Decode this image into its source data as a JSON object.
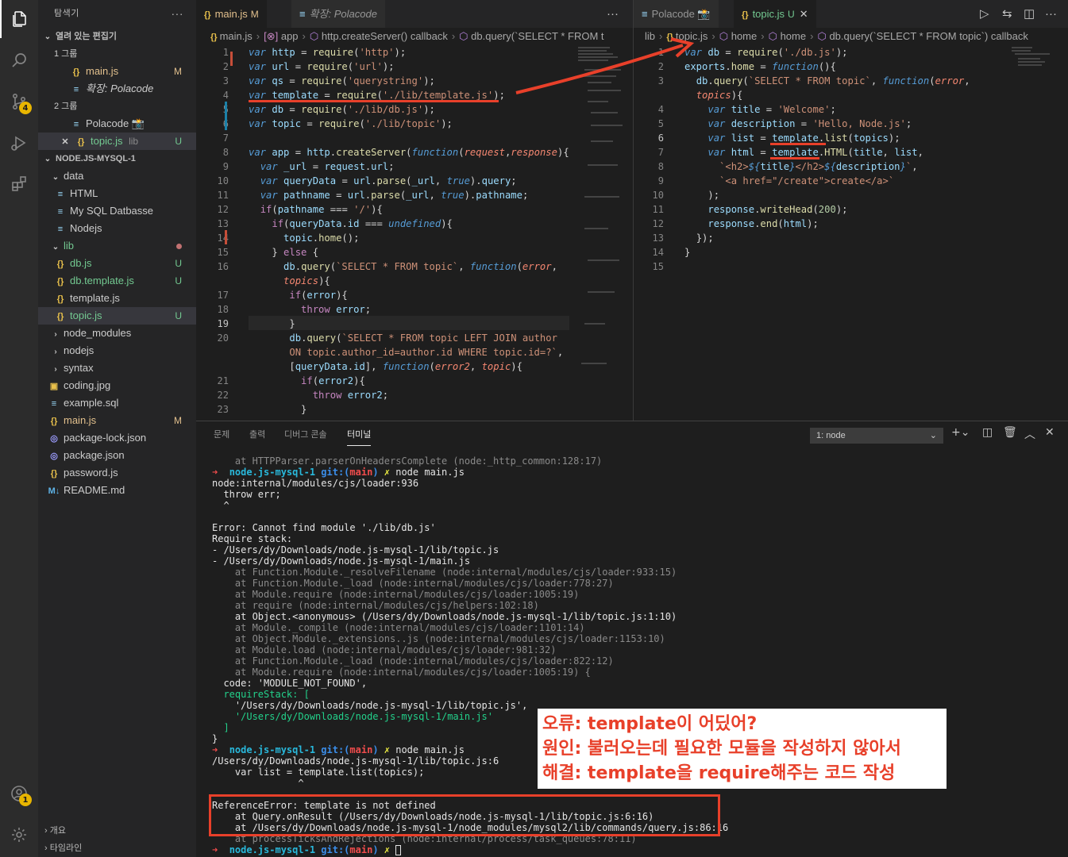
{
  "activity": {
    "scm_badge": "4",
    "account_badge": "1",
    "icons": [
      "files-icon",
      "search-icon",
      "source-control-icon",
      "run-debug-icon",
      "extensions-icon",
      "account-icon",
      "settings-gear-icon"
    ]
  },
  "sidebar": {
    "title": "탐색기",
    "more": "···",
    "open_editors": "열려 있는 편집기",
    "group1": "1 그룹",
    "group2": "2 그룹",
    "open": [
      {
        "label": "main.js",
        "badge": "M"
      },
      {
        "label": "확장: Polacode",
        "badge": ""
      },
      {
        "label": "Polacode 📸",
        "badge": ""
      },
      {
        "label": "topic.js",
        "extra": "lib",
        "badge": "U"
      }
    ],
    "project": "NODE.JS-MYSQL-1",
    "tree": [
      {
        "label": "data",
        "badge": ""
      },
      {
        "label": "HTML",
        "badge": ""
      },
      {
        "label": "My SQL Datbasse",
        "badge": ""
      },
      {
        "label": "Nodejs",
        "badge": ""
      },
      {
        "label": "lib",
        "badge": ""
      },
      {
        "label": "db.js",
        "badge": "U"
      },
      {
        "label": "db.template.js",
        "badge": "U"
      },
      {
        "label": "template.js",
        "badge": ""
      },
      {
        "label": "topic.js",
        "badge": "U"
      },
      {
        "label": "node_modules",
        "badge": ""
      },
      {
        "label": "nodejs",
        "badge": ""
      },
      {
        "label": "syntax",
        "badge": ""
      },
      {
        "label": "coding.jpg",
        "badge": ""
      },
      {
        "label": "example.sql",
        "badge": ""
      },
      {
        "label": "main.js",
        "badge": "M"
      },
      {
        "label": "package-lock.json",
        "badge": ""
      },
      {
        "label": "package.json",
        "badge": ""
      },
      {
        "label": "password.js",
        "badge": ""
      },
      {
        "label": "README.md",
        "badge": ""
      }
    ],
    "outline": "개요",
    "timeline": "타임라인"
  },
  "editor_left": {
    "tabs": [
      {
        "label": "main.js",
        "badge": "M"
      },
      {
        "label": "확장: Polacode"
      }
    ],
    "more": "···",
    "breadcrumb": [
      "main.js",
      "app",
      "http.createServer() callback",
      "db.query(`SELECT * FROM t"
    ],
    "line_numbers": [
      "1",
      "2",
      "3",
      "4",
      "5",
      "6",
      "7",
      "8",
      "9",
      "10",
      "11",
      "12",
      "13",
      "14",
      "15",
      "16",
      "",
      "17",
      "18",
      "19",
      "20",
      "",
      "",
      "21",
      "22",
      "23"
    ],
    "current_line": "19"
  },
  "editor_right": {
    "tabs": [
      {
        "label": "Polacode 📸"
      },
      {
        "label": "topic.js",
        "badge": "U"
      }
    ],
    "breadcrumb": [
      "lib",
      "topic.js",
      "home",
      "home",
      "db.query(`SELECT * FROM topic`) callback"
    ],
    "line_numbers": [
      "1",
      "2",
      "3",
      "",
      "4",
      "5",
      "6",
      "7",
      "8",
      "9",
      "10",
      "11",
      "12",
      "13",
      "14",
      "15"
    ],
    "current_line": "6"
  },
  "panel": {
    "tabs": [
      "문제",
      "출력",
      "디버그 콘솔",
      "터미널"
    ],
    "active_tab": "터미널",
    "terminal_select": "1: node",
    "terminal_lines": [
      "    at HTTPParser.parserOnHeadersComplete (node:_http_common:128:17)",
      "node:internal/modules/cjs/loader:936",
      "  throw err;",
      "  ^",
      "",
      "Error: Cannot find module './lib/db.js'",
      "Require stack:",
      "- /Users/dy/Downloads/node.js-mysql-1/lib/topic.js",
      "- /Users/dy/Downloads/node.js-mysql-1/main.js",
      "    at Function.Module._resolveFilename (node:internal/modules/cjs/loader:933:15)",
      "    at Function.Module._load (node:internal/modules/cjs/loader:778:27)",
      "    at Module.require (node:internal/modules/cjs/loader:1005:19)",
      "    at require (node:internal/modules/cjs/helpers:102:18)",
      "    at Object.<anonymous> (/Users/dy/Downloads/node.js-mysql-1/lib/topic.js:1:10)",
      "    at Module._compile (node:internal/modules/cjs/loader:1101:14)",
      "    at Object.Module._extensions..js (node:internal/modules/cjs/loader:1153:10)",
      "    at Module.load (node:internal/modules/cjs/loader:981:32)",
      "    at Function.Module._load (node:internal/modules/cjs/loader:822:12)",
      "    at Module.require (node:internal/modules/cjs/loader:1005:19) {",
      "  code: 'MODULE_NOT_FOUND',",
      "  requireStack: [",
      "    '/Users/dy/Downloads/node.js-mysql-1/lib/topic.js',",
      "    '/Users/dy/Downloads/node.js-mysql-1/main.js'",
      "  ]",
      "}",
      "/Users/dy/Downloads/node.js-mysql-1/lib/topic.js:6",
      "    var list = template.list(topics);",
      "               ^",
      "",
      "ReferenceError: template is not defined",
      "    at Query.onResult (/Users/dy/Downloads/node.js-mysql-1/lib/topic.js:6:16)",
      "    at /Users/dy/Downloads/node.js-mysql-1/node_modules/mysql2/lib/commands/query.js:86:16",
      "    at processTicksAndRejections (node:internal/process/task_queues:78:11)"
    ],
    "prompt_dir": "node.js-mysql-1",
    "prompt_git": "git:(",
    "prompt_branch": "main",
    "prompt_close": ")",
    "prompt_cmd": "node main.js"
  },
  "annotation": {
    "line1": "오류: template이 어딨어?",
    "line2": "원인: 불러오는데 필요한 모듈을 작성하지 않아서",
    "line3": "해결: template을 require해주는 코드 작성"
  },
  "colors": {
    "accent_red": "#e8402a",
    "modified": "#e2c08d",
    "untracked": "#73c991"
  }
}
